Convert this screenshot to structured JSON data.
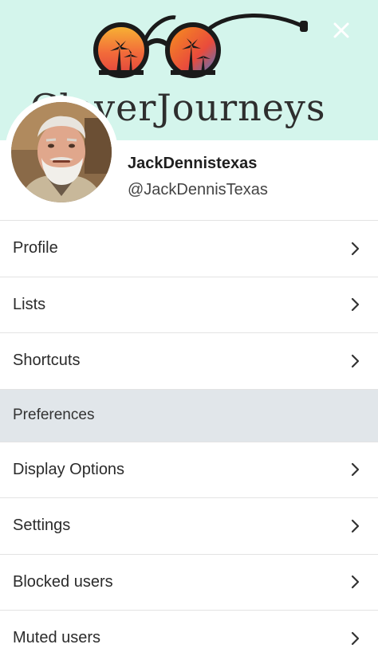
{
  "banner": {
    "wordmark": "CleverJourneys",
    "colors": {
      "background": "#d4f5ec",
      "lens_top": "#f7941d",
      "lens_bottom": "#e94b3c",
      "lens_right": "#c94b9b"
    }
  },
  "close_icon": "close-icon",
  "user": {
    "display_name": "JackDennistexas",
    "handle": "@JackDennisTexas"
  },
  "menu": {
    "items_top": [
      {
        "label": "Profile",
        "icon": "chevron-right-icon"
      },
      {
        "label": "Lists",
        "icon": "chevron-right-icon"
      },
      {
        "label": "Shortcuts",
        "icon": "chevron-right-icon"
      }
    ],
    "section_label": "Preferences",
    "items_bottom": [
      {
        "label": "Display Options",
        "icon": "chevron-right-icon"
      },
      {
        "label": "Settings",
        "icon": "chevron-right-icon"
      },
      {
        "label": "Blocked users",
        "icon": "chevron-right-icon"
      },
      {
        "label": "Muted users",
        "icon": "chevron-right-icon"
      }
    ]
  }
}
